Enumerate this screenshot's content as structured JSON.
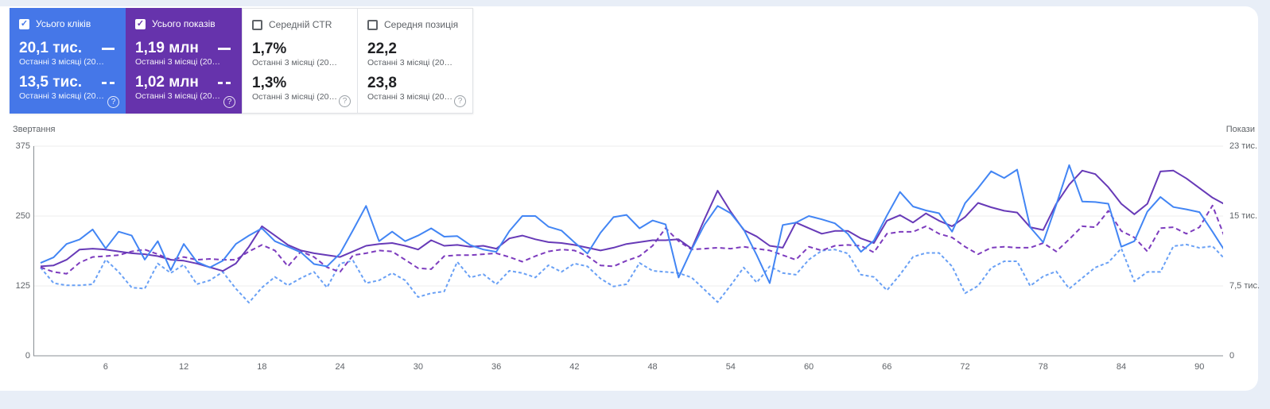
{
  "cards": [
    {
      "label": "Усього кліків",
      "checked": true,
      "color": "#4577e8",
      "current": {
        "value": "20,1 тис.",
        "period": "Останні 3 місяці (20…"
      },
      "previous": {
        "value": "13,5 тис.",
        "period": "Останні 3 місяці (20…"
      },
      "help_glyph": "?"
    },
    {
      "label": "Усього показів",
      "checked": true,
      "color": "#6633ac",
      "current": {
        "value": "1,19 млн",
        "period": "Останні 3 місяці (20…"
      },
      "previous": {
        "value": "1,02 млн",
        "period": "Останні 3 місяці (20…"
      },
      "help_glyph": "?"
    },
    {
      "label": "Середній CTR",
      "checked": false,
      "current": {
        "value": "1,7%",
        "period": "Останні 3 місяці (20…"
      },
      "previous": {
        "value": "1,3%",
        "period": "Останні 3 місяці (20…"
      },
      "help_glyph": "?"
    },
    {
      "label": "Середня позиція",
      "checked": false,
      "current": {
        "value": "22,2",
        "period": "Останні 3 місяці (20…"
      },
      "previous": {
        "value": "23,8",
        "period": "Останні 3 місяці (20…"
      },
      "help_glyph": "?"
    }
  ],
  "checkmark_glyph": "✓",
  "chart": {
    "y_left_title": "Звертання",
    "y_right_title": "Покази"
  },
  "chart_data": {
    "type": "line",
    "x_description": "days 1-92 of a 3-month period",
    "x_tick_days": [
      6,
      12,
      18,
      24,
      30,
      36,
      42,
      48,
      54,
      60,
      66,
      72,
      78,
      84,
      90
    ],
    "left_axis": {
      "title": "Звертання",
      "ticks": [
        "375",
        "250",
        "125",
        "0"
      ],
      "range": [
        0,
        375
      ]
    },
    "right_axis": {
      "title": "Покази",
      "ticks": [
        "23 тис.",
        "15 тис.",
        "7,5 тис.",
        "0"
      ],
      "range_thousands": [
        0,
        23
      ]
    },
    "grid": "horizontal",
    "legend_position": "cards-top-left",
    "series": [
      {
        "name": "Кліки — попередні 3 місяці",
        "axis": "left",
        "style": "dashed",
        "color": "#69a0f5",
        "dash": "4 3",
        "values": [
          158,
          130,
          126,
          126,
          128,
          172,
          150,
          122,
          120,
          165,
          148,
          163,
          128,
          135,
          150,
          120,
          95,
          122,
          141,
          126,
          139,
          150,
          122,
          165,
          170,
          130,
          135,
          148,
          135,
          105,
          112,
          115,
          168,
          140,
          146,
          128,
          152,
          148,
          140,
          162,
          150,
          165,
          160,
          138,
          124,
          128,
          166,
          152,
          150,
          148,
          140,
          118,
          96,
          126,
          158,
          131,
          160,
          148,
          145,
          172,
          188,
          190,
          183,
          145,
          141,
          117,
          145,
          177,
          184,
          184,
          160,
          112,
          125,
          157,
          169,
          169,
          125,
          142,
          151,
          120,
          139,
          158,
          167,
          192,
          133,
          150,
          150,
          196,
          199,
          193,
          196,
          172
        ]
      },
      {
        "name": "Покази — попередні 3 місяці (тис.)",
        "axis": "right",
        "style": "dashed",
        "color": "#7d3cbe",
        "dash": "6 4",
        "values": [
          9.5,
          9.0,
          8.8,
          10.0,
          10.6,
          10.7,
          10.8,
          11.2,
          11.4,
          10.9,
          10.3,
          10.6,
          10.3,
          10.4,
          10.3,
          10.3,
          11.2,
          11.9,
          11.3,
          9.6,
          11.2,
          10.6,
          9.5,
          9.0,
          10.8,
          11.0,
          11.3,
          11.2,
          10.3,
          9.4,
          9.3,
          10.7,
          10.8,
          10.8,
          10.9,
          11.0,
          10.6,
          10.1,
          10.7,
          11.2,
          11.4,
          11.3,
          10.7,
          9.7,
          9.6,
          10.2,
          10.7,
          11.8,
          13.7,
          12.3,
          11.4,
          11.5,
          11.6,
          11.5,
          11.7,
          11.5,
          11.3,
          10.8,
          10.3,
          11.7,
          11.3,
          11.8,
          11.9,
          11.8,
          11.1,
          13.1,
          13.3,
          13.3,
          13.9,
          13.1,
          12.7,
          11.7,
          10.9,
          11.6,
          11.7,
          11.6,
          11.6,
          12.1,
          11.2,
          12.5,
          13.9,
          13.8,
          15.6,
          13.4,
          12.7,
          11.2,
          13.7,
          13.8,
          13.1,
          13.8,
          16.2,
          12.5
        ]
      },
      {
        "name": "Покази — останні 3 місяці (тис.)",
        "axis": "right",
        "style": "solid",
        "color": "#673ab7",
        "dash": "",
        "values": [
          9.6,
          9.7,
          10.3,
          11.4,
          11.5,
          11.4,
          11.2,
          11.0,
          10.9,
          10.7,
          10.3,
          10.2,
          9.9,
          9.5,
          9.1,
          9.9,
          11.7,
          13.9,
          12.9,
          11.9,
          11.3,
          11.0,
          10.8,
          10.6,
          11.2,
          11.8,
          12.0,
          12.1,
          11.8,
          11.4,
          12.4,
          11.8,
          11.9,
          11.7,
          11.8,
          11.5,
          12.6,
          12.9,
          12.5,
          12.2,
          12.1,
          11.9,
          11.6,
          11.3,
          11.6,
          12.0,
          12.2,
          12.4,
          12.4,
          12.5,
          11.5,
          14.7,
          17.9,
          15.5,
          13.5,
          12.8,
          11.8,
          11.6,
          14.3,
          13.7,
          13.1,
          13.4,
          13.4,
          12.6,
          12.1,
          14.5,
          15.1,
          14.3,
          15.3,
          14.5,
          13.9,
          14.9,
          16.5,
          16.0,
          15.6,
          15.4,
          13.8,
          13.5,
          16.4,
          18.6,
          20.2,
          19.8,
          18.3,
          16.4,
          15.2,
          16.4,
          20.1,
          20.2,
          19.3,
          18.2,
          17.1,
          16.3
        ]
      },
      {
        "name": "Кліки — останні 3 місяці",
        "axis": "left",
        "style": "solid",
        "color": "#4285f4",
        "dash": "",
        "values": [
          166,
          176,
          200,
          208,
          226,
          192,
          222,
          215,
          172,
          205,
          153,
          200,
          168,
          158,
          170,
          200,
          215,
          228,
          205,
          195,
          185,
          164,
          160,
          183,
          225,
          268,
          205,
          222,
          205,
          215,
          228,
          213,
          214,
          198,
          190,
          186,
          223,
          250,
          250,
          231,
          224,
          203,
          183,
          220,
          248,
          252,
          228,
          242,
          235,
          140,
          190,
          235,
          268,
          255,
          226,
          180,
          130,
          234,
          238,
          250,
          244,
          237,
          218,
          186,
          206,
          251,
          293,
          267,
          260,
          255,
          222,
          273,
          300,
          330,
          318,
          333,
          230,
          203,
          270,
          341,
          276,
          275,
          272,
          195,
          205,
          258,
          284,
          266,
          262,
          257,
          222,
          186
        ]
      }
    ]
  }
}
